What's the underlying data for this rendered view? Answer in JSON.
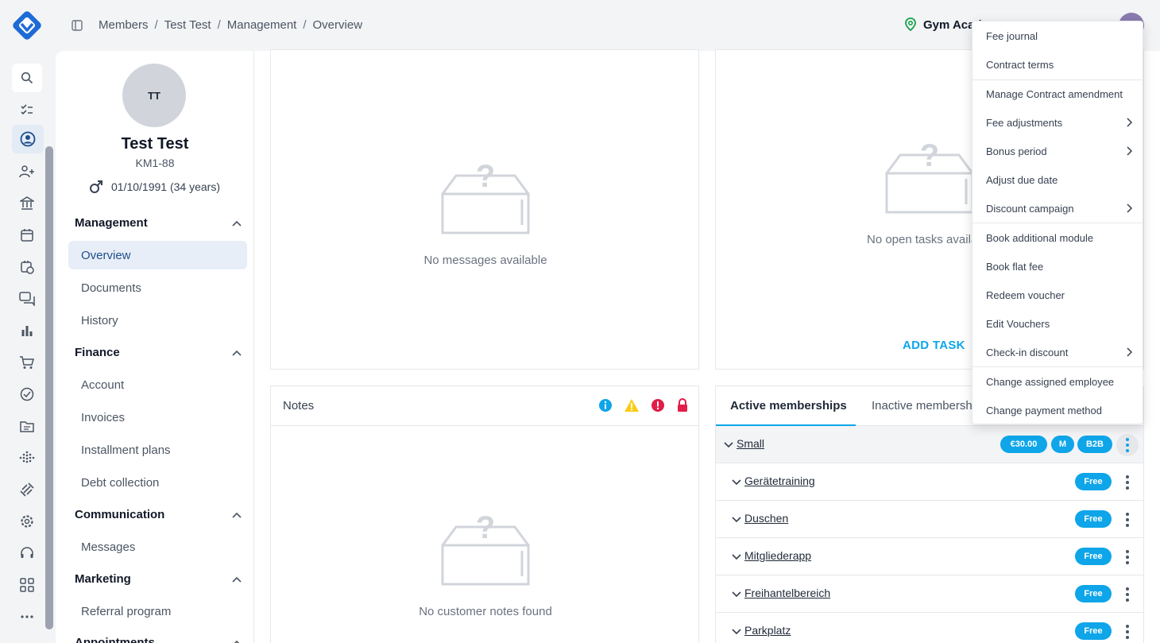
{
  "breadcrumb": [
    "Members",
    "Test Test",
    "Management",
    "Overview"
  ],
  "gym_name": "Gym Acad",
  "profile": {
    "initials": "TT",
    "name": "Test Test",
    "id": "KM1-88",
    "dob": "01/10/1991 (34 years)"
  },
  "nav": {
    "management": "Management",
    "overview": "Overview",
    "documents": "Documents",
    "history": "History",
    "finance": "Finance",
    "account": "Account",
    "invoices": "Invoices",
    "installment_plans": "Installment plans",
    "debt_collection": "Debt collection",
    "communication": "Communication",
    "messages": "Messages",
    "marketing": "Marketing",
    "referral_program": "Referral program",
    "appointments": "Appointments"
  },
  "messages_empty": "No messages available",
  "tasks_empty": "No open tasks availa",
  "add_task": "ADD TASK",
  "notes": {
    "title": "Notes",
    "empty": "No customer notes found"
  },
  "memberships": {
    "tab_active": "Active memberships",
    "tab_inactive": "Inactive membersh",
    "main": {
      "name": "Small",
      "price": "€30.00",
      "badge_m": "M",
      "badge_b2b": "B2B"
    },
    "modules": [
      {
        "name": "Gerätetraining",
        "badge": "Free"
      },
      {
        "name": "Duschen",
        "badge": "Free"
      },
      {
        "name": "Mitgliederapp",
        "badge": "Free"
      },
      {
        "name": "Freihantelbereich",
        "badge": "Free"
      },
      {
        "name": "Parkplatz",
        "badge": "Free"
      }
    ]
  },
  "menu": [
    "Fee journal",
    "Contract terms",
    "Manage Contract amendment",
    "Fee adjustments",
    "Bonus period",
    "Adjust due date",
    "Discount campaign",
    "Book additional module",
    "Book flat fee",
    "Redeem voucher",
    "Edit Vouchers",
    "Check-in discount",
    "Change assigned employee",
    "Change payment method"
  ],
  "colors": {
    "accent": "#0ea5e9",
    "brand": "#1e6bd6",
    "warning": "#facc15",
    "danger": "#e11d48"
  }
}
